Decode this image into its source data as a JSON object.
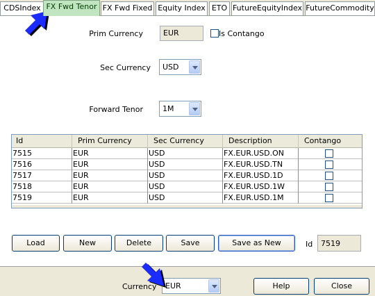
{
  "tabs": [
    {
      "label": "CDSIndex"
    },
    {
      "label": "FX Fwd Tenor"
    },
    {
      "label": "FX Fwd Fixed"
    },
    {
      "label": "Equity Index"
    },
    {
      "label": "ETO"
    },
    {
      "label": "FutureEquityIndex"
    },
    {
      "label": "FutureCommodity"
    }
  ],
  "form": {
    "prim_currency_label": "Prim Currency",
    "prim_currency_value": "EUR",
    "is_contango_label": "Is Contango",
    "is_contango_checked": false,
    "sec_currency_label": "Sec Currency",
    "sec_currency_value": "USD",
    "forward_tenor_label": "Forward Tenor",
    "forward_tenor_value": "1M"
  },
  "table": {
    "columns": [
      "Id",
      "Prim Currency",
      "Sec Currency",
      "Description",
      "Contango"
    ],
    "rows": [
      {
        "id": "7515",
        "prim": "EUR",
        "sec": "USD",
        "desc": "FX.EUR.USD.ON",
        "contango": false
      },
      {
        "id": "7516",
        "prim": "EUR",
        "sec": "USD",
        "desc": "FX.EUR.USD.TN",
        "contango": false
      },
      {
        "id": "7517",
        "prim": "EUR",
        "sec": "USD",
        "desc": "FX.EUR.USD.1D",
        "contango": false
      },
      {
        "id": "7518",
        "prim": "EUR",
        "sec": "USD",
        "desc": "FX.EUR.USD.1W",
        "contango": false
      },
      {
        "id": "7519",
        "prim": "EUR",
        "sec": "USD",
        "desc": "FX.EUR.USD.1M",
        "contango": false
      }
    ]
  },
  "actions": {
    "load": "Load",
    "new": "New",
    "delete": "Delete",
    "save": "Save",
    "save_as_new": "Save as New",
    "id_label": "Id",
    "id_value": "7519"
  },
  "footer": {
    "currency_label": "Currency",
    "currency_value": "EUR",
    "help": "Help",
    "close": "Close"
  },
  "colors": {
    "active_tab": "#c1e5c1",
    "pointer_arrow": "#0000ff"
  }
}
